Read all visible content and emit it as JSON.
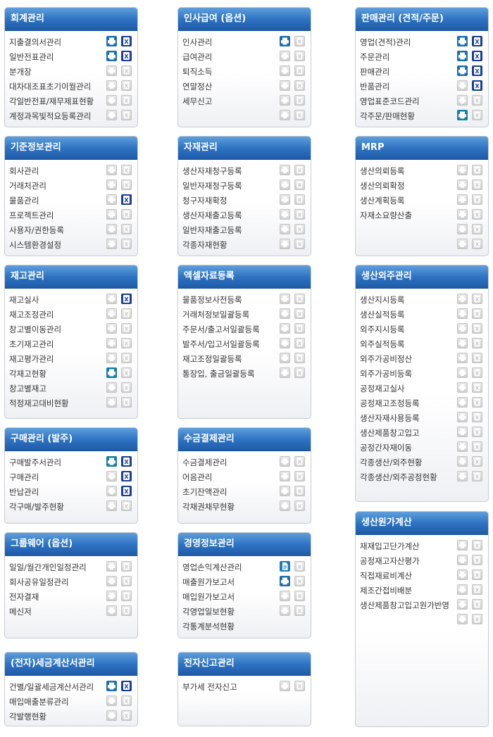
{
  "panels": [
    {
      "title": "회계관리",
      "items": [
        {
          "label": "지출결의서관리",
          "print": "on",
          "excel": "on"
        },
        {
          "label": "일반전표관리",
          "print": "on",
          "excel": "on"
        },
        {
          "label": "분개장",
          "print": "off",
          "excel": "off"
        },
        {
          "label": "대차대조표초기이월관리",
          "print": "off",
          "excel": "off"
        },
        {
          "label": "각일반전표/재무제표현황",
          "print": "off",
          "excel": "off"
        },
        {
          "label": "계정과목빛적요등록관리",
          "print": "off",
          "excel": "off"
        }
      ]
    },
    {
      "title": "인사급여 (옵션)",
      "items": [
        {
          "label": "인사관리",
          "print": "on",
          "excel": "off"
        },
        {
          "label": "급여관리",
          "print": "off",
          "excel": "off"
        },
        {
          "label": "퇴직소득",
          "print": "off",
          "excel": "off"
        },
        {
          "label": "연말정산",
          "print": "off",
          "excel": "off"
        },
        {
          "label": "세무신고",
          "print": "off",
          "excel": "off"
        },
        {
          "label": "",
          "print": "off",
          "excel": "off"
        }
      ]
    },
    {
      "title": "판매관리 (견적/주문)",
      "items": [
        {
          "label": "영업(견적)관리",
          "print": "on",
          "excel": "on"
        },
        {
          "label": "주문관리",
          "print": "on",
          "excel": "on"
        },
        {
          "label": "판매관리",
          "print": "on",
          "excel": "on"
        },
        {
          "label": "반품관리",
          "print": "off",
          "excel": "on"
        },
        {
          "label": "영업표준코드관리",
          "print": "off",
          "excel": "off"
        },
        {
          "label": "각주문/판매현황",
          "print": "teal",
          "excel": "off"
        }
      ]
    },
    {
      "title": "기준정보관리",
      "items": [
        {
          "label": "회사관리",
          "print": "off",
          "excel": "off"
        },
        {
          "label": "거래처관리",
          "print": "off",
          "excel": "off"
        },
        {
          "label": "물품관리",
          "print": "off",
          "excel": "on"
        },
        {
          "label": "프로젝트관리",
          "print": "off",
          "excel": "off"
        },
        {
          "label": "사용자/권한등록",
          "print": "off",
          "excel": "off"
        },
        {
          "label": "시스템환경설정",
          "print": "off",
          "excel": "off"
        }
      ]
    },
    {
      "title": "자재관리",
      "items": [
        {
          "label": "생산자재청구등록",
          "print": "off",
          "excel": "off"
        },
        {
          "label": "일반자재청구등록",
          "print": "off",
          "excel": "off"
        },
        {
          "label": "청구자재확정",
          "print": "off",
          "excel": "off"
        },
        {
          "label": "생산자재출고등록",
          "print": "off",
          "excel": "off"
        },
        {
          "label": "일반자재출고등록",
          "print": "off",
          "excel": "off"
        },
        {
          "label": "각종자재현황",
          "print": "off",
          "excel": "off"
        }
      ]
    },
    {
      "title": "MRP",
      "items": [
        {
          "label": "생산의뢰등록",
          "print": "off",
          "excel": "off"
        },
        {
          "label": "생산의뢰확정",
          "print": "off",
          "excel": "off"
        },
        {
          "label": "생산계획등록",
          "print": "off",
          "excel": "off"
        },
        {
          "label": "자재소요량산출",
          "print": "off",
          "excel": "off"
        },
        {
          "label": "",
          "print": "off",
          "excel": "off"
        },
        {
          "label": "",
          "print": "off",
          "excel": "off"
        }
      ]
    },
    {
      "title": "재고관리",
      "items": [
        {
          "label": "재고실사",
          "print": "off",
          "excel": "on"
        },
        {
          "label": "재고조정관리",
          "print": "off",
          "excel": "off"
        },
        {
          "label": "창고별이동관리",
          "print": "off",
          "excel": "off"
        },
        {
          "label": "초기재고관리",
          "print": "off",
          "excel": "off"
        },
        {
          "label": "재고평가관리",
          "print": "off",
          "excel": "off"
        },
        {
          "label": "각재고현황",
          "print": "teal",
          "excel": "off"
        },
        {
          "label": "창고별재고",
          "print": "off",
          "excel": "off"
        },
        {
          "label": "적정재고대비현황",
          "print": "off",
          "excel": "off"
        }
      ]
    },
    {
      "title": "엑셀자료등록",
      "items": [
        {
          "label": "물품정보사전등록",
          "print": "off",
          "excel": "off"
        },
        {
          "label": "거래처정보일괄등록",
          "print": "off",
          "excel": "off"
        },
        {
          "label": "주문서/출고서일괄등록",
          "print": "off",
          "excel": "off"
        },
        {
          "label": "발주서/입고서일괄등록",
          "print": "off",
          "excel": "off"
        },
        {
          "label": "재고조정일괄등록",
          "print": "off",
          "excel": "off"
        },
        {
          "label": "통장입, 출금일괄등록",
          "print": "off",
          "excel": "off"
        }
      ]
    },
    {
      "title": "생산외주관리",
      "items": [
        {
          "label": "생산지시등록",
          "print": "off",
          "excel": "off"
        },
        {
          "label": "생산실적등록",
          "print": "off",
          "excel": "off"
        },
        {
          "label": "외주지시등록",
          "print": "off",
          "excel": "off"
        },
        {
          "label": "외주실적등록",
          "print": "off",
          "excel": "off"
        },
        {
          "label": "외주가공비정산",
          "print": "off",
          "excel": "off"
        },
        {
          "label": "외주가공비등록",
          "print": "off",
          "excel": "off"
        },
        {
          "label": "공정재고실사",
          "print": "off",
          "excel": "off"
        },
        {
          "label": "공정재고조정등록",
          "print": "off",
          "excel": "off"
        },
        {
          "label": "생산자재사용등록",
          "print": "off",
          "excel": "off"
        },
        {
          "label": "생산제품창고입고",
          "print": "off",
          "excel": "off"
        },
        {
          "label": "공정간자재이동",
          "print": "off",
          "excel": "off"
        },
        {
          "label": "각종생산/외주현황",
          "print": "off",
          "excel": "off"
        },
        {
          "label": "각종생산/외주공정현황",
          "print": "off",
          "excel": "off"
        }
      ]
    },
    {
      "title": "구매관리 (발주)",
      "items": [
        {
          "label": "구매발주서관리",
          "print": "teal",
          "excel": "on"
        },
        {
          "label": "구매관리",
          "print": "off",
          "excel": "on"
        },
        {
          "label": "반납관리",
          "print": "off",
          "excel": "on"
        },
        {
          "label": "각구매/발주현황",
          "print": "off",
          "excel": "off"
        }
      ]
    },
    {
      "title": "수금결제관리",
      "items": [
        {
          "label": "수금결제관리",
          "print": "off",
          "excel": "off"
        },
        {
          "label": "어음관리",
          "print": "off",
          "excel": "off"
        },
        {
          "label": "초기잔액관리",
          "print": "off",
          "excel": "off"
        },
        {
          "label": "각채권채무현황",
          "print": "off",
          "excel": "off"
        }
      ]
    },
    {
      "title": "생산원가계산",
      "items": [
        {
          "label": "재재입고단가계산",
          "print": "off",
          "excel": "off"
        },
        {
          "label": "공정재고자산평가",
          "print": "off",
          "excel": "off"
        },
        {
          "label": "직접재료비계산",
          "print": "off",
          "excel": "off"
        },
        {
          "label": "제조간접비배분",
          "print": "off",
          "excel": "off"
        },
        {
          "label": "생산제품창고입고원가반영",
          "print": "off",
          "excel": "off"
        },
        {
          "label": "",
          "print": "off",
          "excel": "off"
        }
      ]
    },
    {
      "title": "그룹웨어 (옵션)",
      "items": [
        {
          "label": "일일/월간개인일정관리",
          "print": "off",
          "excel": "off"
        },
        {
          "label": "회사공유일정관리",
          "print": "off",
          "excel": "off"
        },
        {
          "label": "전자결재",
          "print": "off",
          "excel": "off"
        },
        {
          "label": "메신저",
          "print": "off",
          "excel": "off"
        }
      ]
    },
    {
      "title": "경영정보관리",
      "items": [
        {
          "label": "영업손익계산관리",
          "print": "doc",
          "excel": "off"
        },
        {
          "label": "매출원가보고서",
          "print": "on",
          "excel": "off"
        },
        {
          "label": "매입원가보고서",
          "print": "off",
          "excel": "off"
        },
        {
          "label": "각영업일보현황",
          "print": "off",
          "excel": "off"
        },
        {
          "label": "각통계분석현황",
          "print": "none",
          "excel": "none"
        }
      ]
    },
    {
      "title": "(전자)세금계산서관리",
      "items": [
        {
          "label": "건별/일괄세금계산서관리",
          "print": "on",
          "excel": "on"
        },
        {
          "label": "매입매출분류관리",
          "print": "off",
          "excel": "off"
        },
        {
          "label": "각발행현황",
          "print": "off",
          "excel": "off"
        }
      ]
    },
    {
      "title": "전자신고관리",
      "items": [
        {
          "label": "부가세 전자신고",
          "print": "off",
          "excel": "off"
        }
      ]
    }
  ]
}
